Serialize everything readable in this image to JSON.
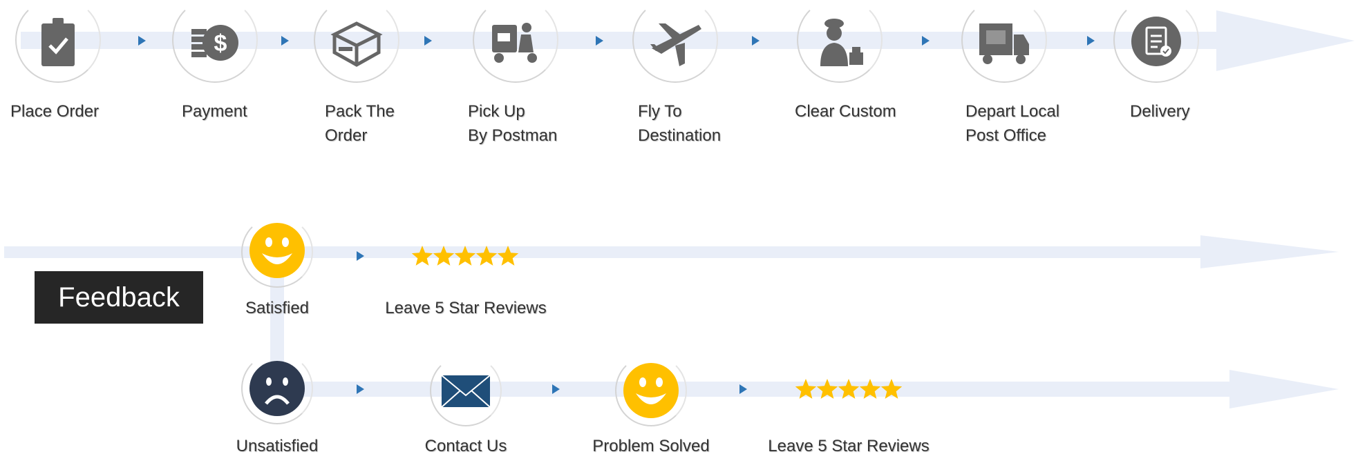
{
  "process": {
    "steps": [
      {
        "label_lines": [
          "Place Order"
        ],
        "icon": "clipboard-check-icon"
      },
      {
        "label_lines": [
          "Payment"
        ],
        "icon": "dollar-coins-icon"
      },
      {
        "label_lines": [
          "Pack The",
          "Order"
        ],
        "icon": "box-icon"
      },
      {
        "label_lines": [
          "Pick Up",
          "By Postman"
        ],
        "icon": "postman-scooter-icon"
      },
      {
        "label_lines": [
          "Fly To",
          "Destination"
        ],
        "icon": "airplane-icon"
      },
      {
        "label_lines": [
          "Clear Custom"
        ],
        "icon": "customs-officer-icon"
      },
      {
        "label_lines": [
          "Depart Local",
          "Post Office"
        ],
        "icon": "delivery-truck-icon"
      },
      {
        "label_lines": [
          "Delivery"
        ],
        "icon": "delivered-clipboard-icon"
      }
    ]
  },
  "feedback": {
    "title": "Feedback",
    "satisfied": {
      "label": "Satisfied",
      "icon": "happy-face-icon",
      "next_label": "Leave 5 Star Reviews",
      "rating": 5
    },
    "unsatisfied": {
      "label": "Unsatisfied",
      "icon": "sad-face-icon",
      "steps": [
        {
          "label": "Contact Us",
          "icon": "envelope-icon"
        },
        {
          "label": "Problem Solved",
          "icon": "happy-face-icon"
        },
        {
          "label": "Leave 5 Star Reviews",
          "icon": "five-stars-icon",
          "rating": 5
        }
      ]
    }
  },
  "colors": {
    "icon_gray": "#666666",
    "smile_yellow": "#ffc000",
    "sad_navy": "#2e3a50",
    "envelope_blue": "#1f4e79",
    "arrow_blue": "#2e75b6",
    "band": "#e9eef8"
  }
}
